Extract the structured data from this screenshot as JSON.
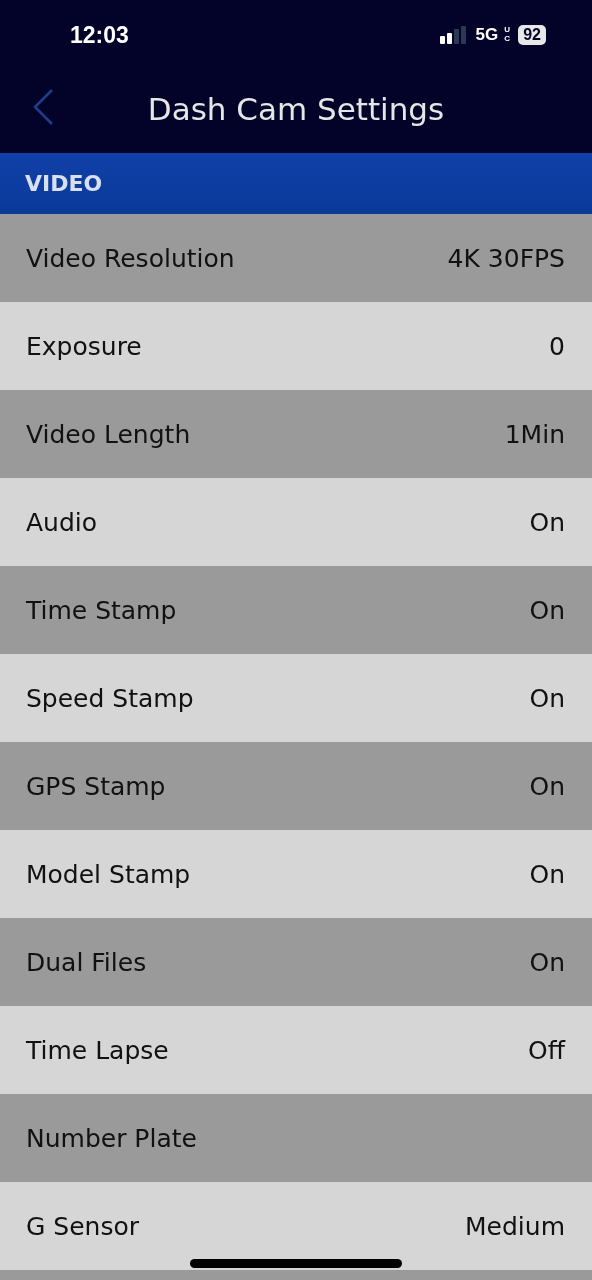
{
  "status_bar": {
    "time": "12:03",
    "network": "5G",
    "network_badge": "UC",
    "battery": "92"
  },
  "header": {
    "title": "Dash Cam Settings"
  },
  "section": {
    "title": "VIDEO"
  },
  "rows": [
    {
      "label": "Video Resolution",
      "value": "4K 30FPS"
    },
    {
      "label": "Exposure",
      "value": "0"
    },
    {
      "label": "Video Length",
      "value": "1Min"
    },
    {
      "label": "Audio",
      "value": "On"
    },
    {
      "label": "Time Stamp",
      "value": "On"
    },
    {
      "label": "Speed Stamp",
      "value": "On"
    },
    {
      "label": "GPS Stamp",
      "value": "On"
    },
    {
      "label": "Model Stamp",
      "value": "On"
    },
    {
      "label": "Dual Files",
      "value": "On"
    },
    {
      "label": "Time Lapse",
      "value": "Off"
    },
    {
      "label": "Number Plate"
    },
    {
      "label": "G Sensor",
      "value": "Medium"
    }
  ]
}
